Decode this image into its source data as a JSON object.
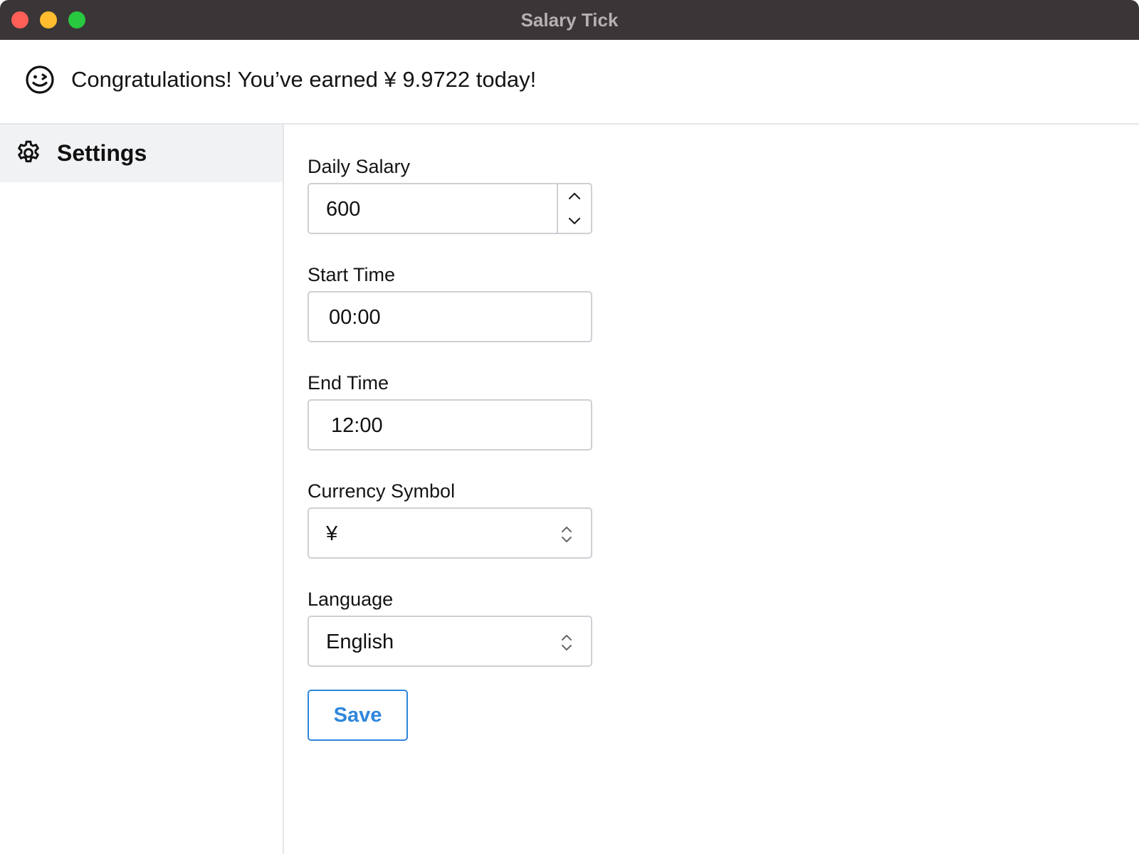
{
  "window": {
    "title": "Salary Tick"
  },
  "banner": {
    "icon": "smiley-wink-icon",
    "message": "Congratulations! You’ve earned ¥ 9.9722 today!"
  },
  "sidebar": {
    "items": [
      {
        "label": "Settings",
        "icon": "gear-icon",
        "selected": true
      }
    ]
  },
  "form": {
    "daily_salary": {
      "label": "Daily Salary",
      "value": "600"
    },
    "start_time": {
      "label": "Start Time",
      "value": "00:00"
    },
    "end_time": {
      "label": "End Time",
      "value": "12:00"
    },
    "currency_symbol": {
      "label": "Currency Symbol",
      "value": "¥"
    },
    "language": {
      "label": "Language",
      "value": "English"
    },
    "save_label": "Save"
  },
  "colors": {
    "titlebar": "#3a3536",
    "accent": "#2f86dc",
    "sidebar_selected": "#f1f2f4",
    "border": "#cdd0d4"
  }
}
